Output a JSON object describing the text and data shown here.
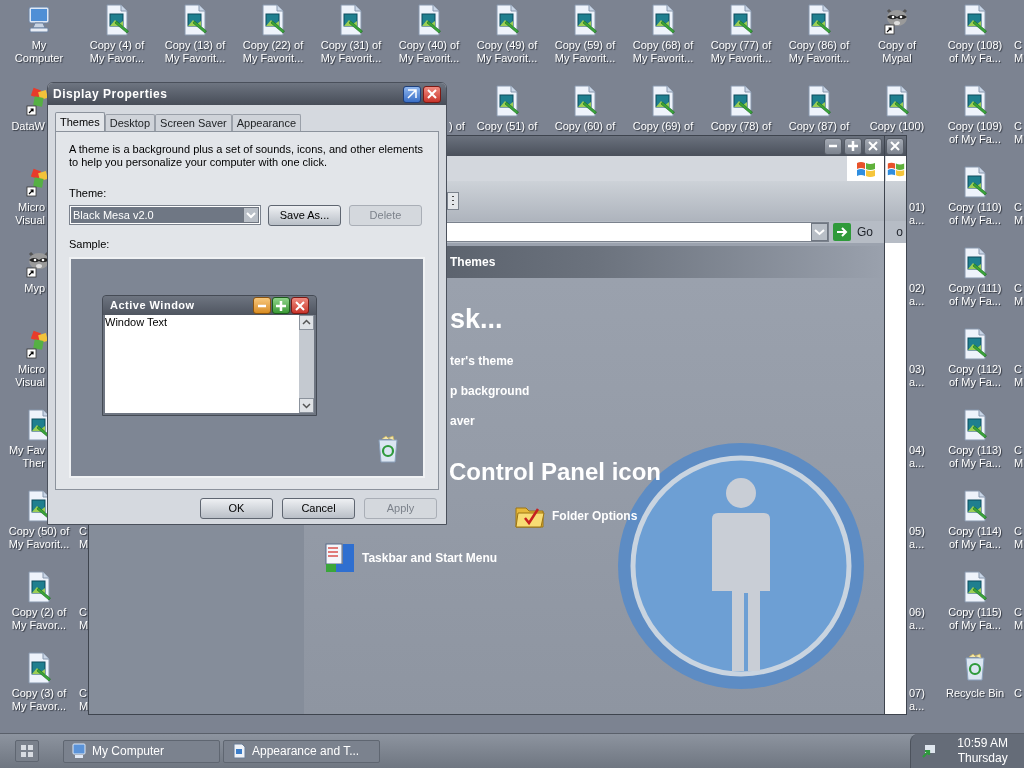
{
  "desktop": {
    "top_row": [
      {
        "kind": "computer",
        "lines": [
          "My",
          "Computer"
        ]
      },
      {
        "kind": "image-file",
        "lines": [
          "Copy (4) of",
          "My Favor..."
        ]
      },
      {
        "kind": "image-file",
        "lines": [
          "Copy (13) of",
          "My Favorit..."
        ]
      },
      {
        "kind": "image-file",
        "lines": [
          "Copy (22) of",
          "My Favorit..."
        ]
      },
      {
        "kind": "image-file",
        "lines": [
          "Copy (31) of",
          "My Favorit..."
        ]
      },
      {
        "kind": "image-file",
        "lines": [
          "Copy (40) of",
          "My Favorit..."
        ]
      },
      {
        "kind": "image-file",
        "lines": [
          "Copy (49) of",
          "My Favorit..."
        ]
      },
      {
        "kind": "image-file",
        "lines": [
          "Copy (59) of",
          "My Favorit..."
        ]
      },
      {
        "kind": "image-file",
        "lines": [
          "Copy (68) of",
          "My Favorit..."
        ]
      },
      {
        "kind": "image-file",
        "lines": [
          "Copy (77) of",
          "My Favorit..."
        ]
      },
      {
        "kind": "image-file",
        "lines": [
          "Copy (86) of",
          "My Favorit..."
        ]
      },
      {
        "kind": "raccoon",
        "lines": [
          "Copy of",
          "Mypal"
        ]
      },
      {
        "kind": "image-file",
        "lines": [
          "Copy (108)",
          "of My Fa..."
        ]
      }
    ],
    "second_row": [
      {
        "kind": "app",
        "lines": [
          "DataW"
        ]
      },
      {
        "kind": "label",
        "lines": [
          ") of"
        ]
      },
      {
        "kind": "image-file",
        "lines": [
          "Copy (51) of"
        ]
      },
      {
        "kind": "image-file",
        "lines": [
          "Copy (60) of"
        ]
      },
      {
        "kind": "image-file",
        "lines": [
          "Copy (69) of"
        ]
      },
      {
        "kind": "image-file",
        "lines": [
          "Copy (78) of"
        ]
      },
      {
        "kind": "image-file",
        "lines": [
          "Copy (87) of"
        ]
      },
      {
        "kind": "image-file",
        "lines": [
          "Copy (100)"
        ]
      },
      {
        "kind": "image-file",
        "lines": [
          "Copy (109)",
          "of My Fa..."
        ]
      }
    ],
    "left_column": [
      {
        "kind": "app",
        "lines": [
          "Micro",
          "Visual"
        ]
      },
      {
        "kind": "raccoon",
        "lines": [
          "Myp"
        ]
      },
      {
        "kind": "app",
        "lines": [
          "Micro",
          "Visual"
        ]
      },
      {
        "kind": "image-file",
        "lines": [
          "My Fav",
          "Ther"
        ]
      },
      {
        "kind": "image-file",
        "lines": [
          "Copy (50) of",
          "My Favorit..."
        ]
      },
      {
        "kind": "image-file",
        "lines": [
          "Copy (2) of",
          "My Favor..."
        ]
      },
      {
        "kind": "image-file",
        "lines": [
          "Copy (3) of",
          "My Favor..."
        ]
      }
    ],
    "second_column_edge": [
      {
        "lines": [
          "C",
          "M"
        ]
      },
      {
        "lines": [
          "C",
          "M"
        ]
      },
      {
        "lines": [
          "C",
          "M"
        ]
      }
    ],
    "right_partial_column": [
      {
        "lines": [
          "01)",
          "a..."
        ]
      },
      {
        "lines": [
          "02)",
          "a..."
        ]
      },
      {
        "lines": [
          "03)",
          "a..."
        ]
      },
      {
        "lines": [
          "04)",
          "a..."
        ]
      },
      {
        "lines": [
          "05)",
          "a..."
        ]
      },
      {
        "lines": [
          "06)",
          "a..."
        ]
      },
      {
        "lines": [
          "07)",
          "a..."
        ]
      }
    ],
    "right_column": [
      {
        "kind": "image-file",
        "lines": [
          "Copy (110)",
          "of My Fa..."
        ]
      },
      {
        "kind": "image-file",
        "lines": [
          "Copy (111)",
          "of My Fa..."
        ]
      },
      {
        "kind": "image-file",
        "lines": [
          "Copy (112)",
          "of My Fa..."
        ]
      },
      {
        "kind": "image-file",
        "lines": [
          "Copy (113)",
          "of My Fa..."
        ]
      },
      {
        "kind": "image-file",
        "lines": [
          "Copy (114)",
          "of My Fa..."
        ]
      },
      {
        "kind": "image-file",
        "lines": [
          "Copy (115)",
          "of My Fa..."
        ]
      },
      {
        "kind": "recycle-bin",
        "lines": [
          "Recycle Bin"
        ]
      }
    ],
    "right_edge": [
      {
        "lines": [
          "C",
          "M"
        ]
      },
      {
        "lines": [
          "C",
          "M"
        ]
      },
      {
        "lines": [
          "C",
          "M"
        ]
      },
      {
        "lines": [
          "C",
          "M"
        ]
      },
      {
        "lines": [
          "C",
          "M"
        ]
      },
      {
        "lines": [
          "C",
          "M"
        ]
      },
      {
        "lines": [
          "C",
          "M"
        ]
      },
      {
        "lines": [
          "C",
          "M"
        ]
      },
      {
        "lines": [
          "C"
        ]
      }
    ]
  },
  "back_window": {
    "go_label": "o"
  },
  "control_panel": {
    "go_label": "Go",
    "header": "Themes",
    "task_heading": "sk...",
    "tasks": [
      "ter's theme",
      "p background",
      "aver"
    ],
    "section_heading": "Control Panel icon",
    "items": [
      {
        "kind": "folder",
        "label": "Folder Options"
      },
      {
        "kind": "taskbar",
        "label": "Taskbar and Start Menu"
      }
    ]
  },
  "dialog": {
    "title": "Display Properties",
    "tabs": [
      {
        "label": "Themes",
        "selected": true
      },
      {
        "label": "Desktop",
        "selected": false
      },
      {
        "label": "Screen Saver",
        "selected": false
      },
      {
        "label": "Appearance",
        "selected": false
      }
    ],
    "description": "A theme is a background plus a set of sounds, icons, and other elements to help you personalize your computer with one click.",
    "theme_label": "Theme:",
    "theme_value": "Black Mesa v2.0",
    "actions": [
      {
        "label": "Save As...",
        "disabled": false
      },
      {
        "label": "Delete",
        "disabled": true
      }
    ],
    "sample_label": "Sample:",
    "sample": {
      "title": "Active Window",
      "text": "Window Text"
    },
    "buttons": [
      {
        "label": "OK",
        "disabled": false
      },
      {
        "label": "Cancel",
        "disabled": false
      },
      {
        "label": "Apply",
        "disabled": true
      }
    ]
  },
  "taskbar": {
    "tasks": [
      {
        "kind": "computer",
        "label": "My Computer"
      },
      {
        "kind": "document",
        "label": "Appearance and T..."
      }
    ],
    "clock": {
      "time": "10:59 AM",
      "day": "Thursday"
    }
  }
}
